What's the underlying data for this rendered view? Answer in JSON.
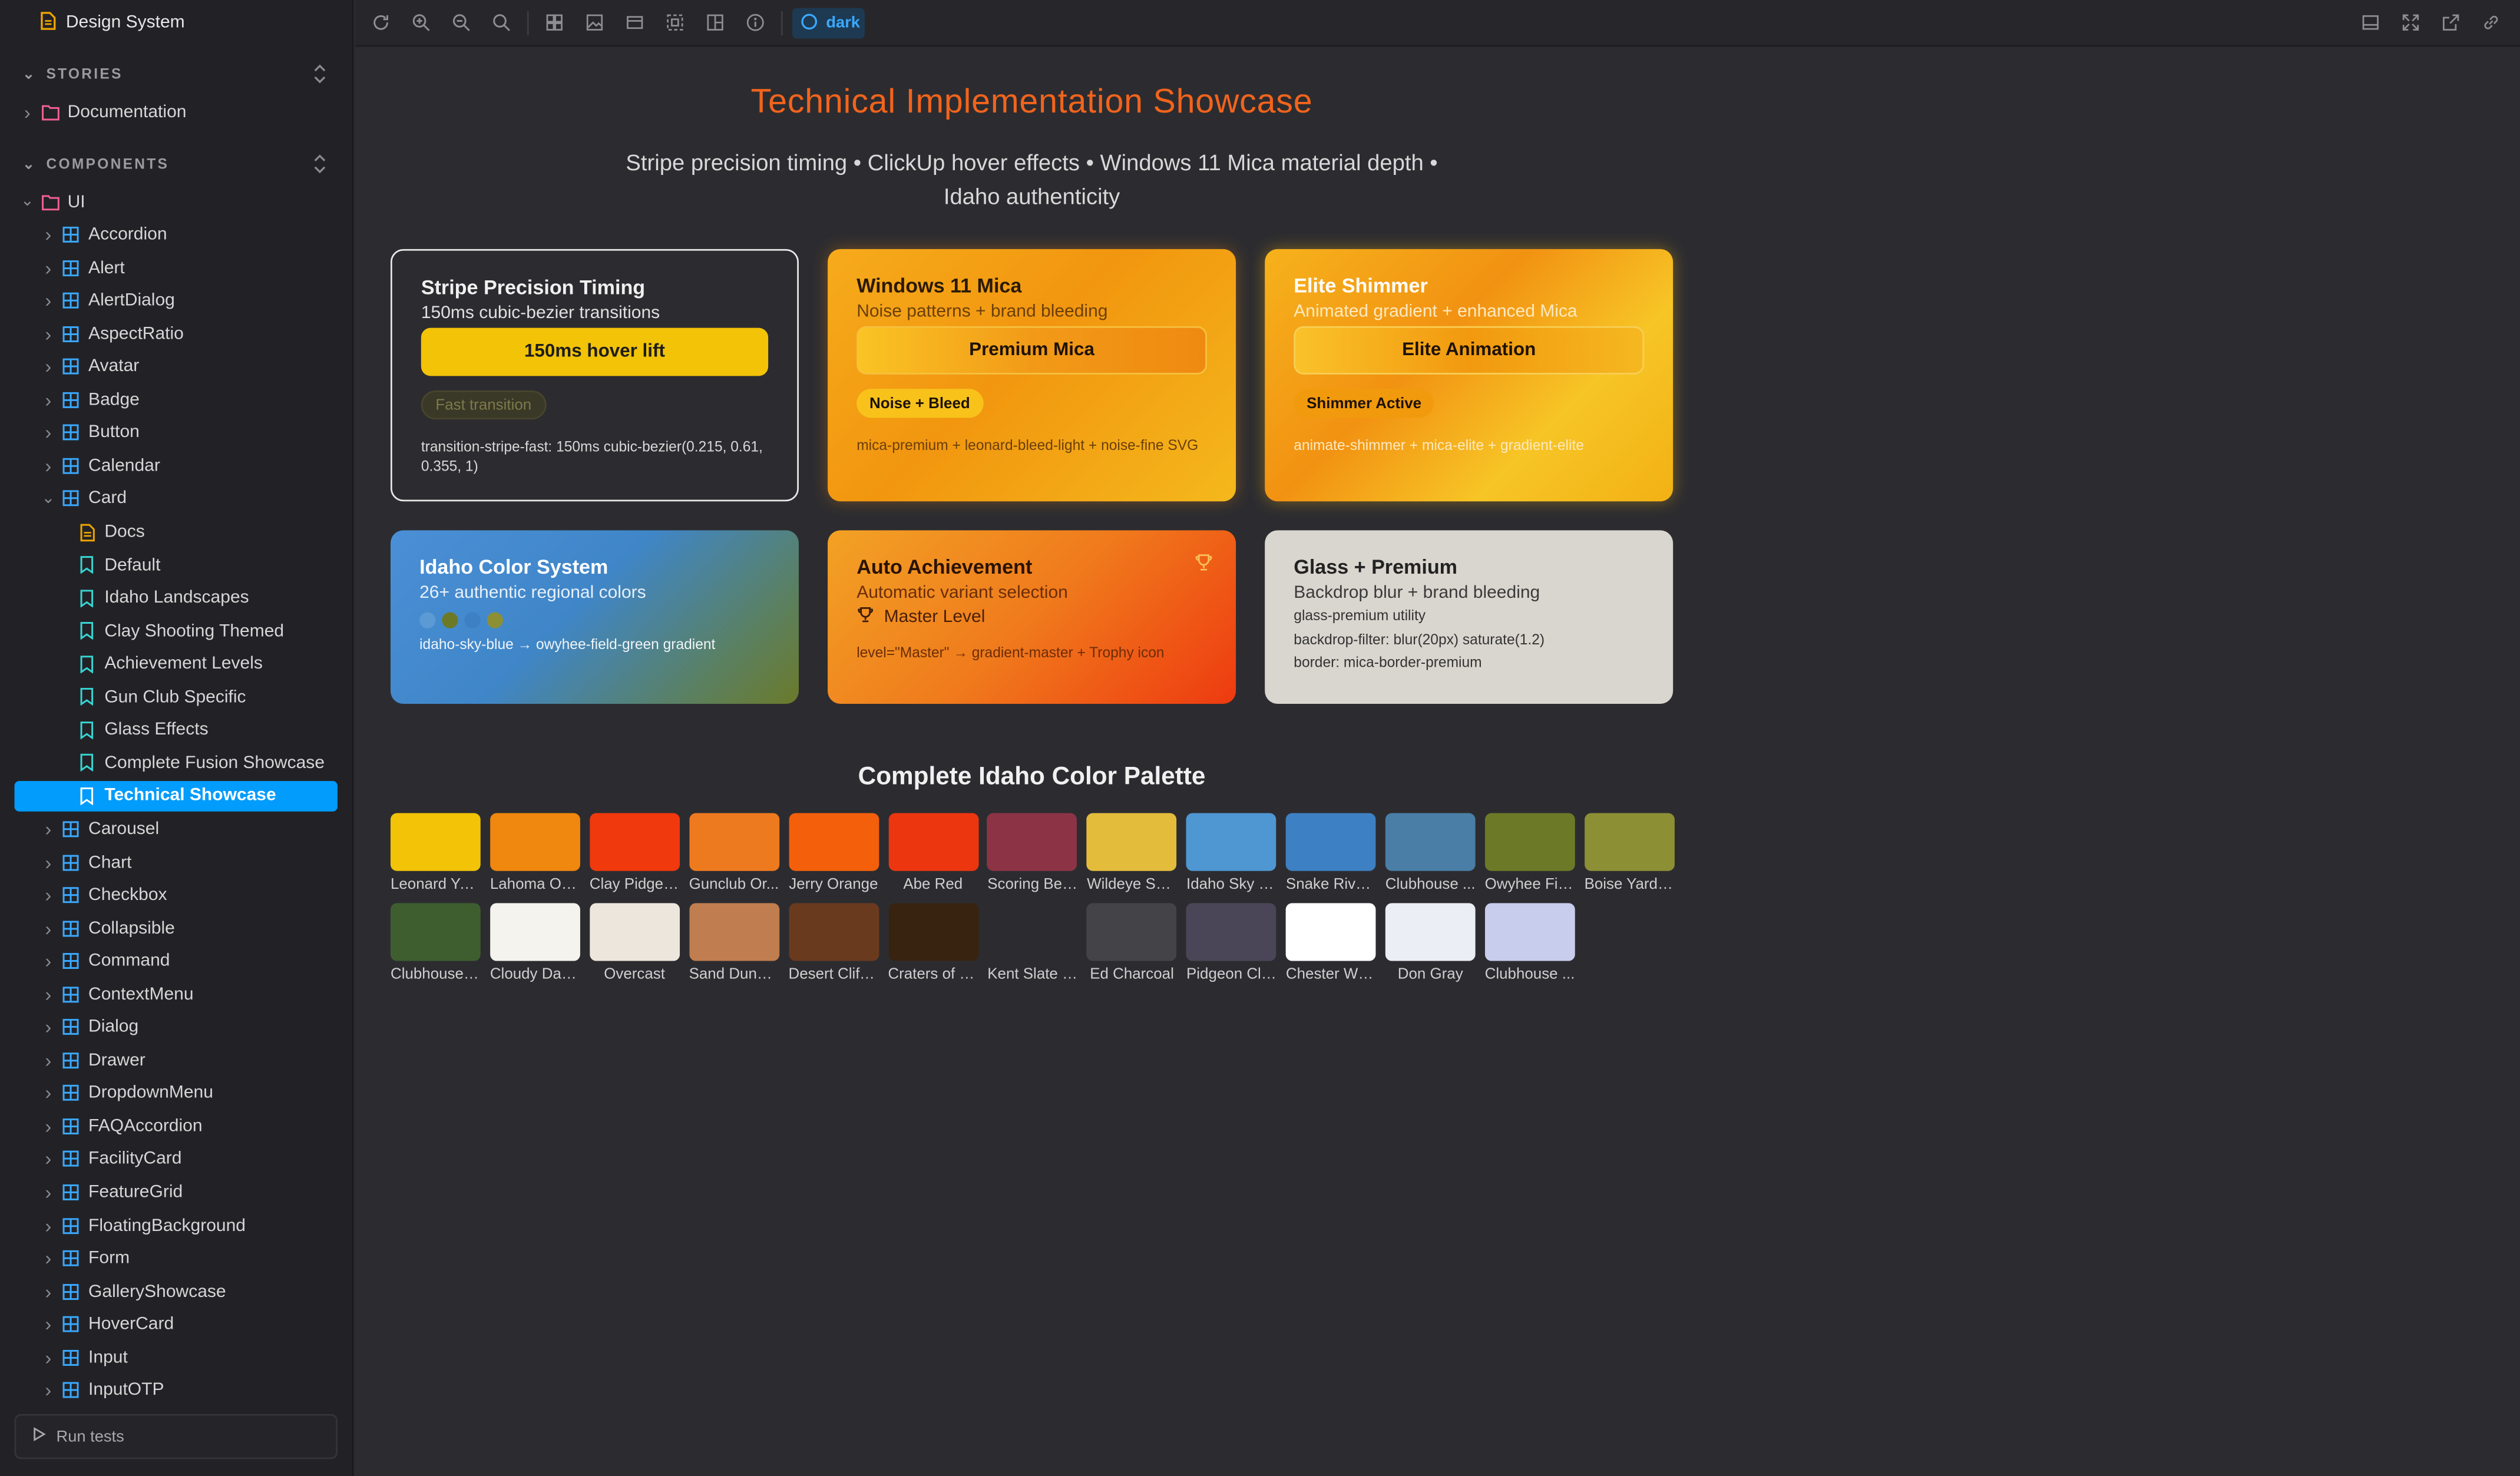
{
  "sidebar": {
    "title": "Design System",
    "sections": {
      "stories": "STORIES",
      "components": "COMPONENTS"
    },
    "tree": [
      {
        "label": "Documentation",
        "type": "folder",
        "depth": 0,
        "chev": "right"
      },
      {
        "label": "UI",
        "type": "folder",
        "depth": 0,
        "chev": "down"
      },
      {
        "label": "Accordion",
        "type": "component",
        "depth": 1,
        "chev": "right"
      },
      {
        "label": "Alert",
        "type": "component",
        "depth": 1,
        "chev": "right"
      },
      {
        "label": "AlertDialog",
        "type": "component",
        "depth": 1,
        "chev": "right"
      },
      {
        "label": "AspectRatio",
        "type": "component",
        "depth": 1,
        "chev": "right"
      },
      {
        "label": "Avatar",
        "type": "component",
        "depth": 1,
        "chev": "right"
      },
      {
        "label": "Badge",
        "type": "component",
        "depth": 1,
        "chev": "right"
      },
      {
        "label": "Button",
        "type": "component",
        "depth": 1,
        "chev": "right"
      },
      {
        "label": "Calendar",
        "type": "component",
        "depth": 1,
        "chev": "right"
      },
      {
        "label": "Card",
        "type": "component",
        "depth": 1,
        "chev": "down"
      },
      {
        "label": "Docs",
        "type": "doc",
        "depth": 2,
        "chev": ""
      },
      {
        "label": "Default",
        "type": "story",
        "depth": 2,
        "chev": ""
      },
      {
        "label": "Idaho Landscapes",
        "type": "story",
        "depth": 2,
        "chev": ""
      },
      {
        "label": "Clay Shooting Themed",
        "type": "story",
        "depth": 2,
        "chev": ""
      },
      {
        "label": "Achievement Levels",
        "type": "story",
        "depth": 2,
        "chev": ""
      },
      {
        "label": "Gun Club Specific",
        "type": "story",
        "depth": 2,
        "chev": ""
      },
      {
        "label": "Glass Effects",
        "type": "story",
        "depth": 2,
        "chev": ""
      },
      {
        "label": "Complete Fusion Showcase",
        "type": "story",
        "depth": 2,
        "chev": ""
      },
      {
        "label": "Technical Showcase",
        "type": "story",
        "depth": 2,
        "chev": "",
        "selected": true
      },
      {
        "label": "Carousel",
        "type": "component",
        "depth": 1,
        "chev": "right"
      },
      {
        "label": "Chart",
        "type": "component",
        "depth": 1,
        "chev": "right"
      },
      {
        "label": "Checkbox",
        "type": "component",
        "depth": 1,
        "chev": "right"
      },
      {
        "label": "Collapsible",
        "type": "component",
        "depth": 1,
        "chev": "right"
      },
      {
        "label": "Command",
        "type": "component",
        "depth": 1,
        "chev": "right"
      },
      {
        "label": "ContextMenu",
        "type": "component",
        "depth": 1,
        "chev": "right"
      },
      {
        "label": "Dialog",
        "type": "component",
        "depth": 1,
        "chev": "right"
      },
      {
        "label": "Drawer",
        "type": "component",
        "depth": 1,
        "chev": "right"
      },
      {
        "label": "DropdownMenu",
        "type": "component",
        "depth": 1,
        "chev": "right"
      },
      {
        "label": "FAQAccordion",
        "type": "component",
        "depth": 1,
        "chev": "right"
      },
      {
        "label": "FacilityCard",
        "type": "component",
        "depth": 1,
        "chev": "right"
      },
      {
        "label": "FeatureGrid",
        "type": "component",
        "depth": 1,
        "chev": "right"
      },
      {
        "label": "FloatingBackground",
        "type": "component",
        "depth": 1,
        "chev": "right"
      },
      {
        "label": "Form",
        "type": "component",
        "depth": 1,
        "chev": "right"
      },
      {
        "label": "GalleryShowcase",
        "type": "component",
        "depth": 1,
        "chev": "right"
      },
      {
        "label": "HoverCard",
        "type": "component",
        "depth": 1,
        "chev": "right"
      },
      {
        "label": "Input",
        "type": "component",
        "depth": 1,
        "chev": "right"
      },
      {
        "label": "InputOTP",
        "type": "component",
        "depth": 1,
        "chev": "right"
      }
    ],
    "run_tests": "Run tests"
  },
  "toolbar": {
    "left_icons": [
      "reload-icon",
      "zoom-in-icon",
      "zoom-out-icon",
      "zoom-reset-icon",
      "grid-icon",
      "background-icon",
      "viewport-icon",
      "outline-icon",
      "measure-icon",
      "accessibility-icon"
    ],
    "theme_label": "dark",
    "right_icons": [
      "sidebar-toggle-icon",
      "fullscreen-icon",
      "open-new-tab-icon",
      "copy-link-icon"
    ]
  },
  "main": {
    "title": "Technical Implementation Showcase",
    "subtitle": "Stripe precision timing • ClickUp hover effects • Windows 11 Mica material depth • Idaho authenticity",
    "cards": [
      {
        "title": "Stripe Precision Timing",
        "subtitle": "150ms cubic-bezier transitions",
        "button": "150ms hover lift",
        "pill": "Fast transition",
        "desc": "transition-stripe-fast: 150ms cubic-bezier(0.215, 0.61, 0.355, 1)"
      },
      {
        "title": "Windows 11 Mica",
        "subtitle": "Noise patterns + brand bleeding",
        "button": "Premium Mica",
        "pill": "Noise + Bleed",
        "desc": "mica-premium + leonard-bleed-light + noise-fine SVG"
      },
      {
        "title": "Elite Shimmer",
        "subtitle": "Animated gradient + enhanced Mica",
        "button": "Elite Animation",
        "pill": "Shimmer Active",
        "desc": "animate-shimmer + mica-elite + gradient-elite"
      },
      {
        "title": "Idaho Color System",
        "subtitle": "26+ authentic regional colors",
        "desc": "idaho-sky-blue → owyhee-field-green gradient"
      },
      {
        "title": "Auto Achievement",
        "subtitle": "Automatic variant selection",
        "badge": "Master Level",
        "desc": "level=\"Master\" → gradient-master + Trophy icon"
      },
      {
        "title": "Glass + Premium",
        "subtitle": "Backdrop blur + brand bleeding",
        "lines": [
          "glass-premium utility",
          "backdrop-filter: blur(20px) saturate(1.2)",
          "border: mica-border-premium"
        ]
      }
    ],
    "palette_title": "Complete Idaho Color Palette",
    "palette": [
      {
        "name": "Leonard Yell...",
        "color": "#f2c307"
      },
      {
        "name": "Lahoma Ora...",
        "color": "#f0870e"
      },
      {
        "name": "Clay Pidgeo...",
        "color": "#f0390c"
      },
      {
        "name": "Gunclub Or...",
        "color": "#ee7a1f"
      },
      {
        "name": "Jerry Orange",
        "color": "#f35f0b"
      },
      {
        "name": "Abe Red",
        "color": "#ec360f"
      },
      {
        "name": "Scoring Ben...",
        "color": "#8c3446"
      },
      {
        "name": "Wildeye Sus...",
        "color": "#e4bc3c"
      },
      {
        "name": "Idaho Sky Bl...",
        "color": "#4e97d3"
      },
      {
        "name": "Snake River ...",
        "color": "#3d80c3"
      },
      {
        "name": "Clubhouse ...",
        "color": "#4a7ea6"
      },
      {
        "name": "Owyhee Fiel...",
        "color": "#6c7a27"
      },
      {
        "name": "Boise Yard ...",
        "color": "#8d8f35"
      },
      {
        "name": "Clubhouse L...",
        "color": "#3f5e30"
      },
      {
        "name": "Cloudy Day ...",
        "color": "#f5f3ee"
      },
      {
        "name": "Overcast",
        "color": "#ede6dd"
      },
      {
        "name": "Sand Dune ...",
        "color": "#c07d4f"
      },
      {
        "name": "Desert Cliff ...",
        "color": "#6a3a1f"
      },
      {
        "name": "Craters of th...",
        "color": "#372310"
      },
      {
        "name": "Kent Slate G...",
        "color": "#2c2c30"
      },
      {
        "name": "Ed Charcoal",
        "color": "#444448"
      },
      {
        "name": "Pidgeon Cla...",
        "color": "#4a4658"
      },
      {
        "name": "Chester White",
        "color": "#ffffff"
      },
      {
        "name": "Don Gray",
        "color": "#eceef6"
      },
      {
        "name": "Clubhouse ...",
        "color": "#c8cdee"
      }
    ]
  }
}
